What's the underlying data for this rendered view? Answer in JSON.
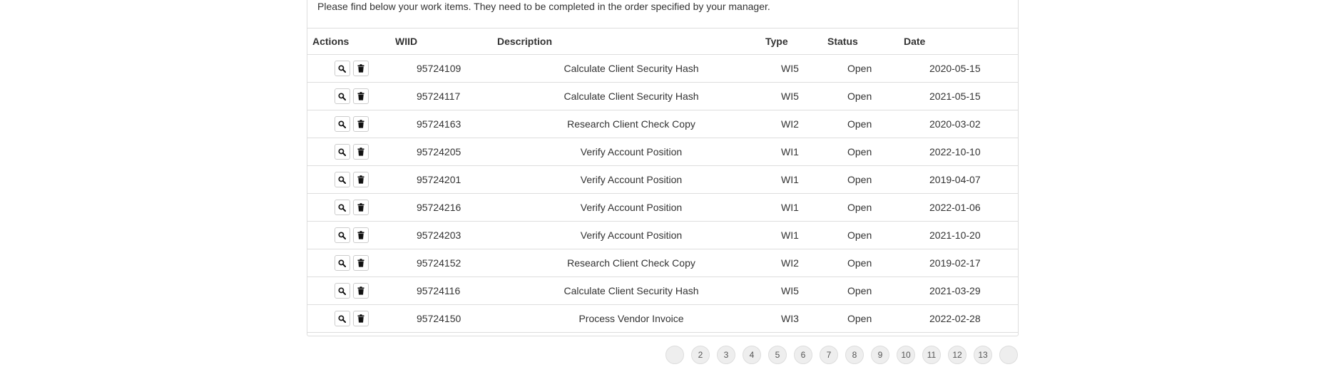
{
  "intro_text": "Please find below your work items. They need to be completed in the order specified by your manager.",
  "table": {
    "headers": {
      "actions": "Actions",
      "wiid": "WIID",
      "description": "Description",
      "type": "Type",
      "status": "Status",
      "date": "Date"
    },
    "rows": [
      {
        "wiid": "95724109",
        "description": "Calculate Client Security Hash",
        "type": "WI5",
        "status": "Open",
        "date": "2020-05-15"
      },
      {
        "wiid": "95724117",
        "description": "Calculate Client Security Hash",
        "type": "WI5",
        "status": "Open",
        "date": "2021-05-15"
      },
      {
        "wiid": "95724163",
        "description": "Research Client Check Copy",
        "type": "WI2",
        "status": "Open",
        "date": "2020-03-02"
      },
      {
        "wiid": "95724205",
        "description": "Verify Account Position",
        "type": "WI1",
        "status": "Open",
        "date": "2022-10-10"
      },
      {
        "wiid": "95724201",
        "description": "Verify Account Position",
        "type": "WI1",
        "status": "Open",
        "date": "2019-04-07"
      },
      {
        "wiid": "95724216",
        "description": "Verify Account Position",
        "type": "WI1",
        "status": "Open",
        "date": "2022-01-06"
      },
      {
        "wiid": "95724203",
        "description": "Verify Account Position",
        "type": "WI1",
        "status": "Open",
        "date": "2021-10-20"
      },
      {
        "wiid": "95724152",
        "description": "Research Client Check Copy",
        "type": "WI2",
        "status": "Open",
        "date": "2019-02-17"
      },
      {
        "wiid": "95724116",
        "description": "Calculate Client Security Hash",
        "type": "WI5",
        "status": "Open",
        "date": "2021-03-29"
      },
      {
        "wiid": "95724150",
        "description": "Process Vendor Invoice",
        "type": "WI3",
        "status": "Open",
        "date": "2022-02-28"
      }
    ],
    "row_actions": [
      "search-icon",
      "trash-icon"
    ]
  },
  "pagination": {
    "pages": [
      "",
      "2",
      "3",
      "4",
      "5",
      "6",
      "7",
      "8",
      "9",
      "10",
      "11",
      "12",
      "13",
      ""
    ]
  }
}
